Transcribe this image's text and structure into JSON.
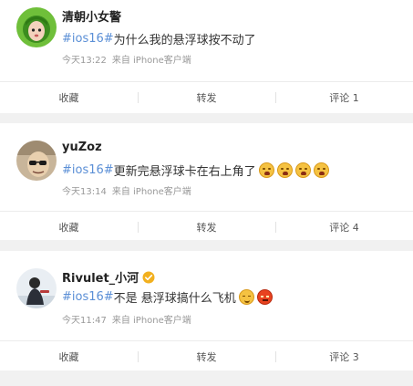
{
  "posts": [
    {
      "username": "清朝小女警",
      "hashtag": "#ios16#",
      "text": "为什么我的悬浮球按不动了",
      "time": "今天13:22",
      "source": "来自 iPhone客户端",
      "actions": {
        "favorite": "收藏",
        "repost": "转发",
        "comment": "评论 1"
      },
      "emojis": []
    },
    {
      "username": "yuZoz",
      "hashtag": "#ios16#",
      "text": "更新完悬浮球卡在右上角了",
      "time": "今天13:14",
      "source": "来自 iPhone客户端",
      "actions": {
        "favorite": "收藏",
        "repost": "转发",
        "comment": "评论 4"
      },
      "emojis": [
        "crying-laughing-emoji",
        "crying-laughing-emoji",
        "crying-laughing-emoji",
        "crying-laughing-emoji"
      ]
    },
    {
      "username": "Rivulet_小河",
      "verified": true,
      "hashtag": "#ios16#",
      "text": "不是 悬浮球搞什么飞机",
      "time": "今天11:47",
      "source": "来自 iPhone客户端",
      "actions": {
        "favorite": "收藏",
        "repost": "转发",
        "comment": "评论 3"
      },
      "emojis": [
        "smug-emoji",
        "angry-emoji"
      ]
    }
  ],
  "colors": {
    "hashtag": "#5b8fd6",
    "background": "#f1f1f1",
    "card": "#ffffff",
    "meta_text": "#999999",
    "verified_badge": "#f2b01e"
  }
}
